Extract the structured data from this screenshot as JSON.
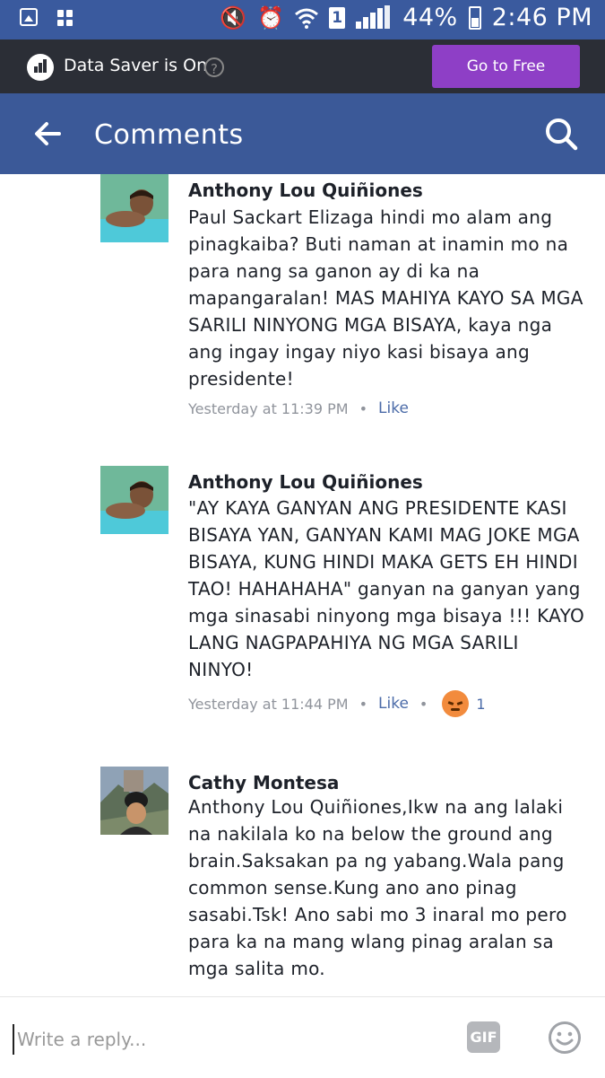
{
  "status_bar": {
    "battery": "44%",
    "time": "2:46 PM",
    "sim": "1",
    "network": "R"
  },
  "data_saver": {
    "label": "Data Saver is On",
    "help": "?",
    "button": "Go to Free"
  },
  "header": {
    "title": "Comments"
  },
  "comments": [
    {
      "author": "Anthony Lou Quiñiones",
      "lines": [
        "Paul Sackart Elizaga hindi mo alam ang",
        "pinagkaiba? Buti naman at inamin mo na",
        "para nang sa ganon ay di ka na",
        "mapangaralan! MAS MAHIYA KAYO SA MGA",
        "SARILI NINYONG MGA BISAYA, kaya nga",
        "ang ingay ingay niyo kasi bisaya ang",
        "presidente!"
      ],
      "time": "Yesterday at 11:39 PM",
      "like": "Like"
    },
    {
      "author": "Anthony Lou Quiñiones",
      "lines": [
        "\"AY KAYA GANYAN ANG PRESIDENTE KASI",
        "BISAYA YAN, GANYAN KAMI MAG JOKE MGA",
        "BISAYA, KUNG HINDI MAKA GETS EH HINDI",
        "TAO! HAHAHAHA\"  ganyan na ganyan yang",
        "mga sinasabi ninyong mga bisaya !!! KAYO",
        "LANG NAGPAPAHIYA NG MGA SARILI",
        "NINYO!"
      ],
      "time": "Yesterday at 11:44 PM",
      "like": "Like",
      "reaction_count": "1"
    },
    {
      "author": "Cathy Montesa",
      "lines": [
        "Anthony Lou Quiñiones,Ikw na ang lalaki",
        "na nakilala ko na below the ground ang",
        "brain.Saksakan pa ng yabang.Wala pang",
        "common sense.Kung ano ano pinag",
        "sasabi.Tsk! Ano sabi mo 3 inaral mo pero",
        "para ka na mang wlang pinag aralan sa",
        "mga salita mo."
      ]
    }
  ],
  "reply": {
    "placeholder": "Write a reply...",
    "gif": "GIF"
  },
  "icons": {
    "back": "arrow-left-icon",
    "search": "search-icon",
    "reaction": "angry-reaction-icon",
    "emoji": "smiley-icon"
  },
  "colors": {
    "header": "#3b5998",
    "status_bar": "#3a5a9e",
    "data_saver_bg": "#2b2e36",
    "go_free_button": "#8e3fc6",
    "link": "#4b6ba8"
  }
}
